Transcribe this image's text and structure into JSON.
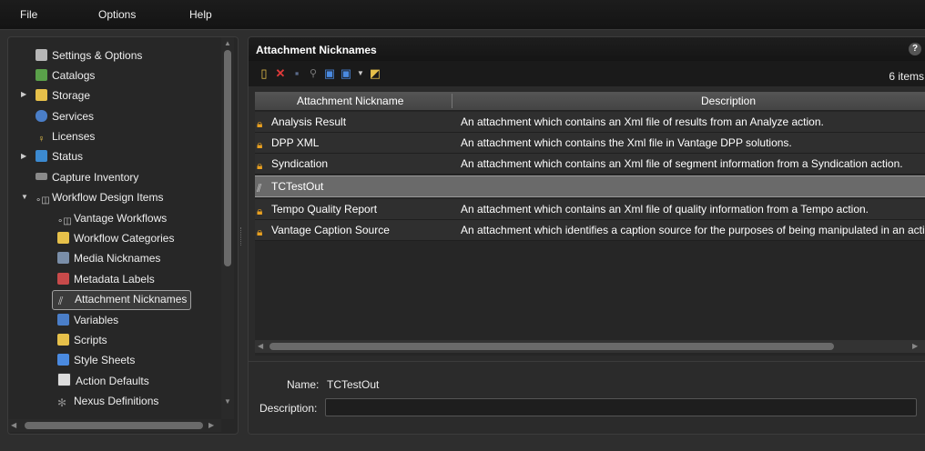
{
  "menu": {
    "file": "File",
    "options": "Options",
    "help": "Help"
  },
  "sidebar": {
    "items": [
      {
        "label": "Settings & Options",
        "icon": "settings-icon"
      },
      {
        "label": "Catalogs",
        "icon": "catalogs-icon"
      },
      {
        "label": "Storage",
        "icon": "folder-icon",
        "expandable": true
      },
      {
        "label": "Services",
        "icon": "services-icon"
      },
      {
        "label": "Licenses",
        "icon": "key-icon"
      },
      {
        "label": "Status",
        "icon": "status-chart-icon",
        "expandable": true
      },
      {
        "label": "Capture Inventory",
        "icon": "capture-icon"
      },
      {
        "label": "Workflow Design Items",
        "icon": "workflow-icon",
        "expanded": true
      },
      {
        "label": "Vantage Workflows",
        "icon": "workflow-icon"
      },
      {
        "label": "Workflow Categories",
        "icon": "folder-icon"
      },
      {
        "label": "Media Nicknames",
        "icon": "media-icon"
      },
      {
        "label": "Metadata Labels",
        "icon": "metadata-icon"
      },
      {
        "label": "Attachment Nicknames",
        "icon": "paperclip-icon",
        "selected": true
      },
      {
        "label": "Variables",
        "icon": "variables-icon"
      },
      {
        "label": "Scripts",
        "icon": "scripts-icon"
      },
      {
        "label": "Style Sheets",
        "icon": "stylesheet-icon"
      },
      {
        "label": "Action Defaults",
        "icon": "action-defaults-icon"
      },
      {
        "label": "Nexus Definitions",
        "icon": "nexus-icon"
      }
    ]
  },
  "main": {
    "title": "Attachment Nicknames",
    "help": "?",
    "item_count": "6 items",
    "columns": {
      "nickname": "Attachment Nickname",
      "description": "Description"
    },
    "rows": [
      {
        "name": "Analysis Result",
        "description": "An attachment which contains an Xml file of results from an Analyze action.",
        "locked": true
      },
      {
        "name": "DPP XML",
        "description": "An attachment which contains the Xml file in Vantage DPP solutions.",
        "locked": true
      },
      {
        "name": "Syndication",
        "description": "An attachment which contains an Xml file of segment information from a Syndication action.",
        "locked": true
      },
      {
        "name": "TCTestOut",
        "description": "",
        "locked": false,
        "selected": true
      },
      {
        "name": "Tempo Quality Report",
        "description": "An attachment which contains an Xml file of quality information from a Tempo action.",
        "locked": true
      },
      {
        "name": "Vantage Caption Source",
        "description": "An attachment which identifies a caption source for the purposes of being manipulated in an action.",
        "locked": true
      }
    ]
  },
  "details": {
    "name_label": "Name:",
    "name_value": "TCTestOut",
    "description_label": "Description:",
    "description_value": ""
  },
  "colors": {
    "background": "#2e2e2e",
    "panel": "#272727",
    "selected_row": "#6a6a6a",
    "lock": "#e8a020"
  }
}
